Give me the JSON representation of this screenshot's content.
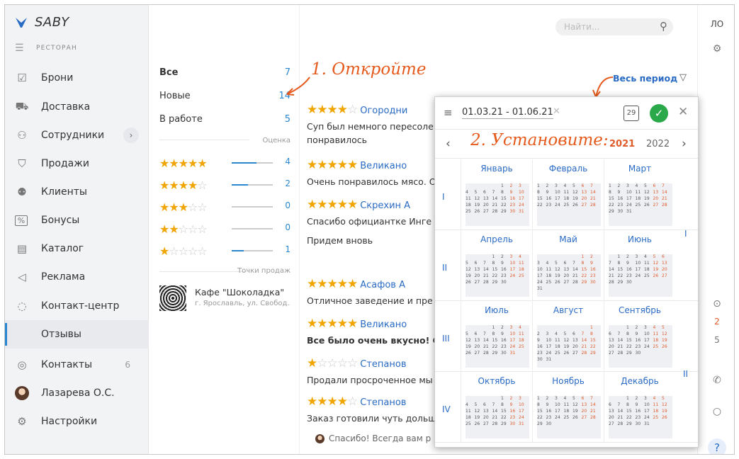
{
  "app": {
    "logo": "SABY",
    "section": "РЕСТОРАН"
  },
  "sidebar": {
    "items": [
      {
        "label": "Брони",
        "icon": "clipboard-check-icon"
      },
      {
        "label": "Доставка",
        "icon": "delivery-icon"
      },
      {
        "label": "Сотрудники",
        "icon": "users-icon"
      },
      {
        "label": "Продажи",
        "icon": "cart-icon"
      },
      {
        "label": "Клиенты",
        "icon": "clients-icon"
      },
      {
        "label": "Бонусы",
        "icon": "percent-icon"
      },
      {
        "label": "Каталог",
        "icon": "catalog-icon"
      },
      {
        "label": "Реклама",
        "icon": "megaphone-icon"
      },
      {
        "label": "Контакт-центр",
        "icon": "headset-icon"
      },
      {
        "label": "Отзывы"
      },
      {
        "label": "Контакты",
        "icon": "chat-icon",
        "badge": "6"
      },
      {
        "label": "Лазарева О.С.",
        "icon": "avatar"
      },
      {
        "label": "Настройки",
        "icon": "gear-icon"
      }
    ]
  },
  "filters": {
    "statuses": [
      {
        "label": "Все",
        "count": "7"
      },
      {
        "label": "Новые",
        "count": "14"
      },
      {
        "label": "В работе",
        "count": "5"
      }
    ],
    "rating_head": "Оценка",
    "ratings": [
      {
        "stars": 5,
        "count": "4",
        "share": 0.6
      },
      {
        "stars": 4,
        "count": "2",
        "share": 0.4
      },
      {
        "stars": 3,
        "count": "0",
        "share": 0
      },
      {
        "stars": 2,
        "count": "0",
        "share": 0
      },
      {
        "stars": 1,
        "count": "1",
        "share": 0.3
      }
    ],
    "points_head": "Точки продаж",
    "place": {
      "name": "Кафе \"Шоколадка\"",
      "address": "г. Ярославль, ул. Свобод..."
    }
  },
  "search": {
    "placeholder": "Найти..."
  },
  "topright": {
    "user": "ЛО"
  },
  "rightbar": {
    "count_red": "2",
    "count": "5",
    "help": "?"
  },
  "period_label": "Весь период",
  "reviews": [
    {
      "stars": 4,
      "name": "Огородни",
      "text": "Суп был немного пересоле",
      "text2": "понравилось"
    },
    {
      "stars": 5,
      "name": "Великано",
      "text": "Очень понравилось мясо. О"
    },
    {
      "stars": 5,
      "name": "Скрехин А",
      "text": "Спасибо официантке Инге",
      "text2": "Придем вновь"
    },
    {
      "stars": 5,
      "name": "Асафов А",
      "text": "Отличное заведение и пре"
    },
    {
      "stars": 5,
      "name": "Великано",
      "text": "Все было очень вкусно! Сп",
      "bold": true
    },
    {
      "stars": 1,
      "name": "Степанов",
      "text": "Продали просроченное мы"
    },
    {
      "stars": 4,
      "name": "Степанов",
      "text": "Заказ готовили чуть дольш"
    }
  ],
  "reply": "Спасибо! Всегда вам р",
  "annotations": {
    "a1": "1. Откройте",
    "a2": "2. Установите:"
  },
  "calendar": {
    "range": "01.03.21 - 01.06.21",
    "day_icon": "29",
    "years": [
      "2021",
      "2022"
    ],
    "quarters": [
      "I",
      "II",
      "III",
      "IV"
    ],
    "halves": [
      "I",
      "II"
    ],
    "months": [
      "Январь",
      "Февраль",
      "Март",
      "Апрель",
      "Май",
      "Июнь",
      "Июль",
      "Август",
      "Сентябрь",
      "Октябрь",
      "Ноябрь",
      "Декабрь"
    ]
  }
}
